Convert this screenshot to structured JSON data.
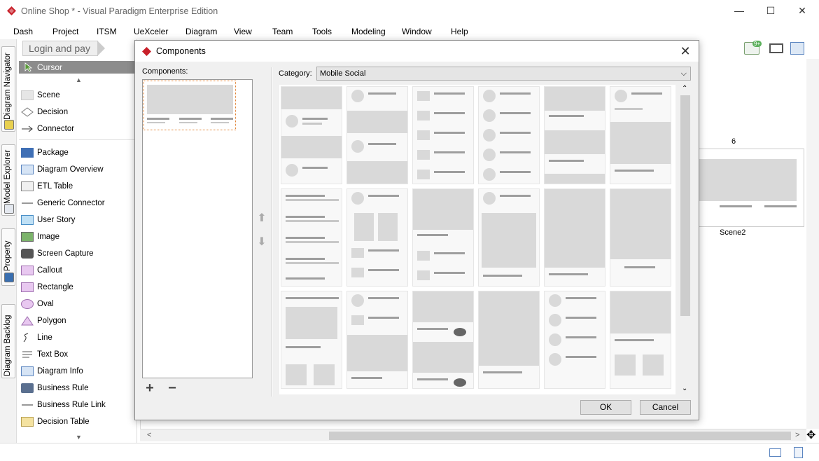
{
  "window": {
    "title": "Online Shop * - Visual Paradigm Enterprise Edition",
    "minimize": "—",
    "maximize": "☐",
    "close": "✕"
  },
  "menu": [
    "Dash",
    "Project",
    "ITSM",
    "UeXceler",
    "Diagram",
    "View",
    "Team",
    "Tools",
    "Modeling",
    "Window",
    "Help"
  ],
  "left_tabs": [
    "Diagram Navigator",
    "Model Explorer",
    "Property",
    "Diagram Backlog"
  ],
  "breadcrumb": "Login and pay",
  "palette": {
    "cursor": "Cursor",
    "items": [
      "Scene",
      "Decision",
      "Connector",
      "Package",
      "Diagram Overview",
      "ETL Table",
      "Generic Connector",
      "User Story",
      "Image",
      "Screen Capture",
      "Callout",
      "Rectangle",
      "Oval",
      "Polygon",
      "Line",
      "Text Box",
      "Diagram Info",
      "Business Rule",
      "Business Rule Link",
      "Decision Table"
    ]
  },
  "canvas": {
    "scene_number": "6",
    "scene_label": "Scene2"
  },
  "toolbar": {
    "notification_badge": "9+"
  },
  "dialog": {
    "title": "Components",
    "components_label": "Components:",
    "category_label": "Category:",
    "category_value": "Mobile Social",
    "ok_label": "OK",
    "cancel_label": "Cancel",
    "add_symbol": "+",
    "remove_symbol": "−"
  },
  "colors": {
    "accent_red": "#c8202a",
    "selection_orange": "#e08030",
    "cursor_row": "#8c8c8c"
  }
}
